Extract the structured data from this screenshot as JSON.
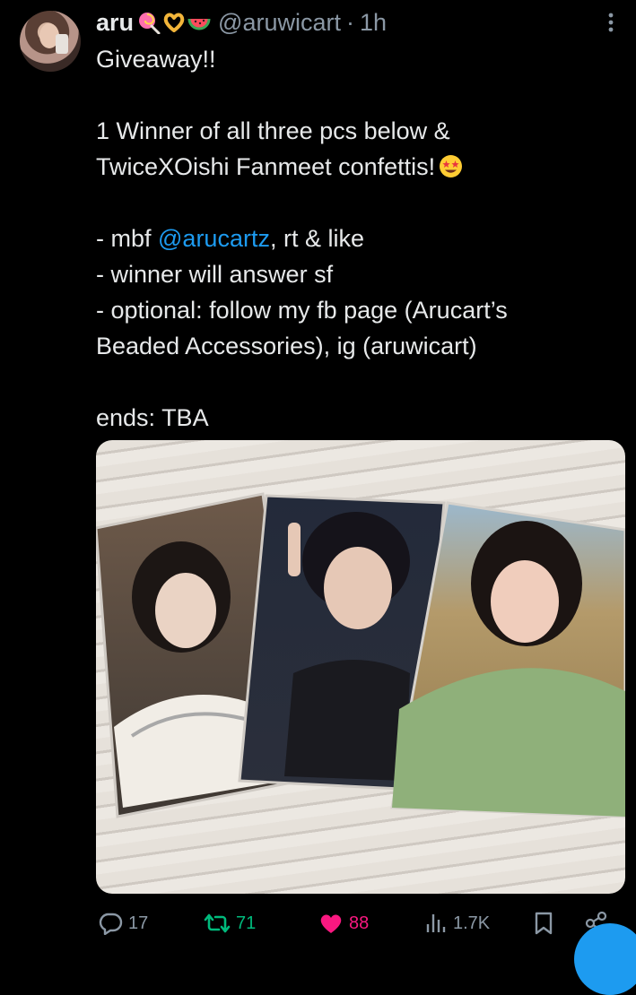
{
  "tweet": {
    "display_name": "aru",
    "name_emojis": [
      "lollipop-emoji",
      "heart-hands-emoji",
      "watermelon-emoji"
    ],
    "handle": "@aruwicart",
    "separator": "·",
    "time": "1h",
    "lines": {
      "l1": "Giveaway!!",
      "l2": "1 Winner of all three pcs below &",
      "l3": "TwiceXOishi Fanmeet confettis!",
      "l4_prefix": "- mbf ",
      "l4_mention": "@arucartz",
      "l4_suffix": ", rt & like",
      "l5": "- winner will answer sf",
      "l6": "- optional: follow my fb page (Arucart’s",
      "l7": "Beaded Accessories), ig (aruwicart)",
      "l8": "ends: TBA"
    },
    "trailing_emoji": "star-struck-emoji"
  },
  "media": {
    "description_icon": "photocards-image"
  },
  "actions": {
    "reply_count": "17",
    "retweet_count": "71",
    "like_count": "88",
    "views_count": "1.7K"
  },
  "colors": {
    "background": "#000000",
    "text": "#e7e9ea",
    "muted": "#8b98a5",
    "link": "#1d9bf0",
    "retweet": "#00ba7c",
    "like": "#f91880"
  }
}
